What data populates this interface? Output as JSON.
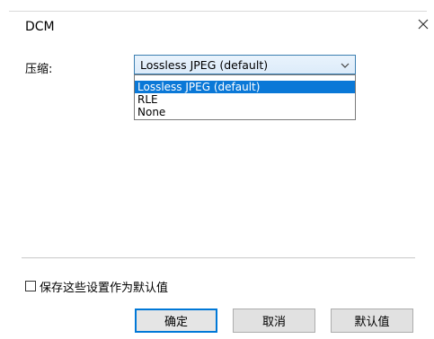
{
  "window": {
    "title": "DCM",
    "close_icon": "close-icon"
  },
  "compression": {
    "label": "压缩:",
    "selected": "Lossless JPEG (default)",
    "options": [
      "Lossless JPEG (default)",
      "RLE",
      "None"
    ],
    "chevron_icon": "chevron-down-icon"
  },
  "remember": {
    "label": "保存这些设置作为默认值",
    "checked": false
  },
  "buttons": {
    "ok": "确定",
    "cancel": "取消",
    "default": "默认值"
  },
  "colors": {
    "accent": "#0078d7",
    "selection": "#0a78d7"
  }
}
